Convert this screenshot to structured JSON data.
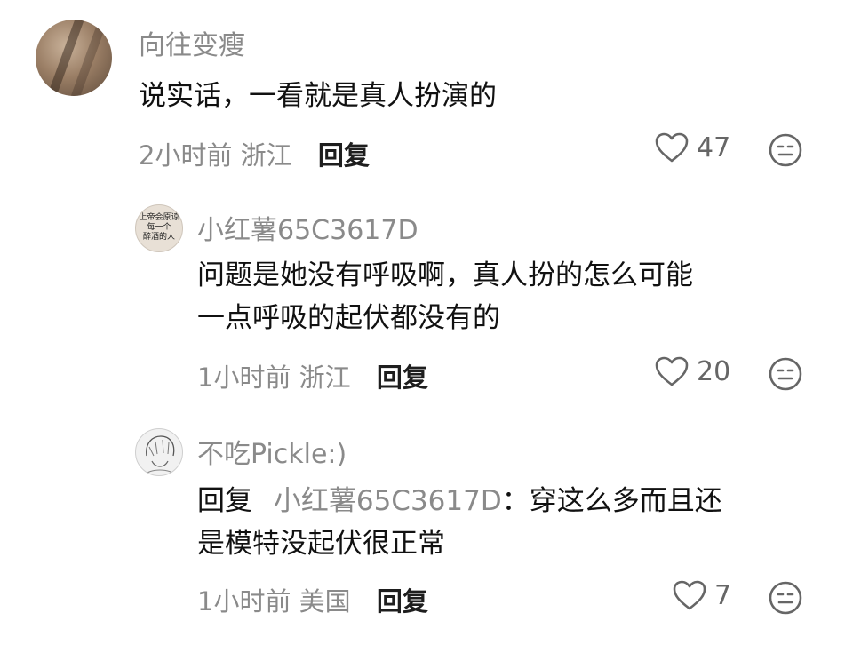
{
  "comments": [
    {
      "username": "向往变瘦",
      "text_lines": [
        "说实话，一看就是真人扮演的"
      ],
      "time": "2小时前",
      "location": "浙江",
      "reply_label": "回复",
      "likes": "47"
    },
    {
      "username": "小红薯65C3617D",
      "avatar_text": [
        "上帝会原谅",
        "每一个",
        "醉酒的人"
      ],
      "text_lines": [
        "问题是她没有呼吸啊，真人扮的怎么可能",
        "一点呼吸的起伏都没有的"
      ],
      "time": "1小时前",
      "location": "浙江",
      "reply_label": "回复",
      "likes": "20"
    },
    {
      "username": "不吃Pickle:)",
      "reply_prefix": "回复",
      "mention": "小红薯65C3617D",
      "text_line1_rest": "：穿这么多而且还",
      "text_line2": "是模特没起伏很正常",
      "time": "1小时前",
      "location": "美国",
      "reply_label": "回复",
      "likes": "7"
    }
  ],
  "icons": {
    "like": "heart-outline-icon",
    "emoji": "emoji-face-icon"
  },
  "colors": {
    "meta": "#8a8a8a",
    "text": "#111111",
    "background": "#ffffff"
  }
}
